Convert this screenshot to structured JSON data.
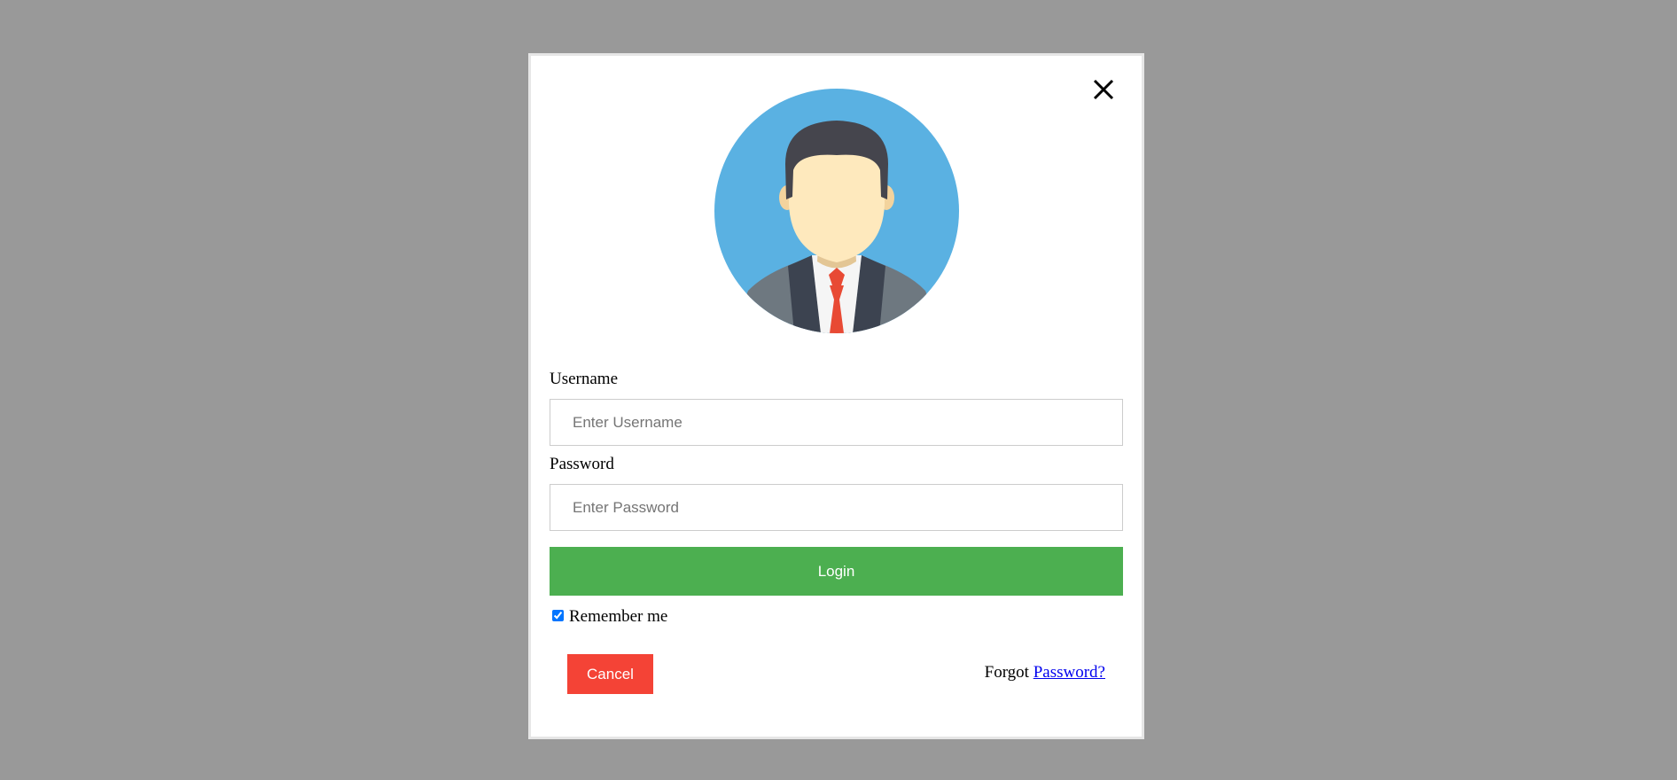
{
  "modal": {
    "close_icon": "close-icon",
    "avatar_icon": "user-avatar-icon",
    "username_label": "Username",
    "username_placeholder": "Enter Username",
    "password_label": "Password",
    "password_placeholder": "Enter Password",
    "login_label": "Login",
    "remember_label": "Remember me",
    "remember_checked": true,
    "cancel_label": "Cancel",
    "forgot_prefix": "Forgot",
    "forgot_link": "Password?"
  },
  "colors": {
    "overlay": "#999999",
    "login": "#4caf50",
    "cancel": "#f44336",
    "avatar_bg": "#5ab1e2",
    "link": "#0000ee"
  }
}
